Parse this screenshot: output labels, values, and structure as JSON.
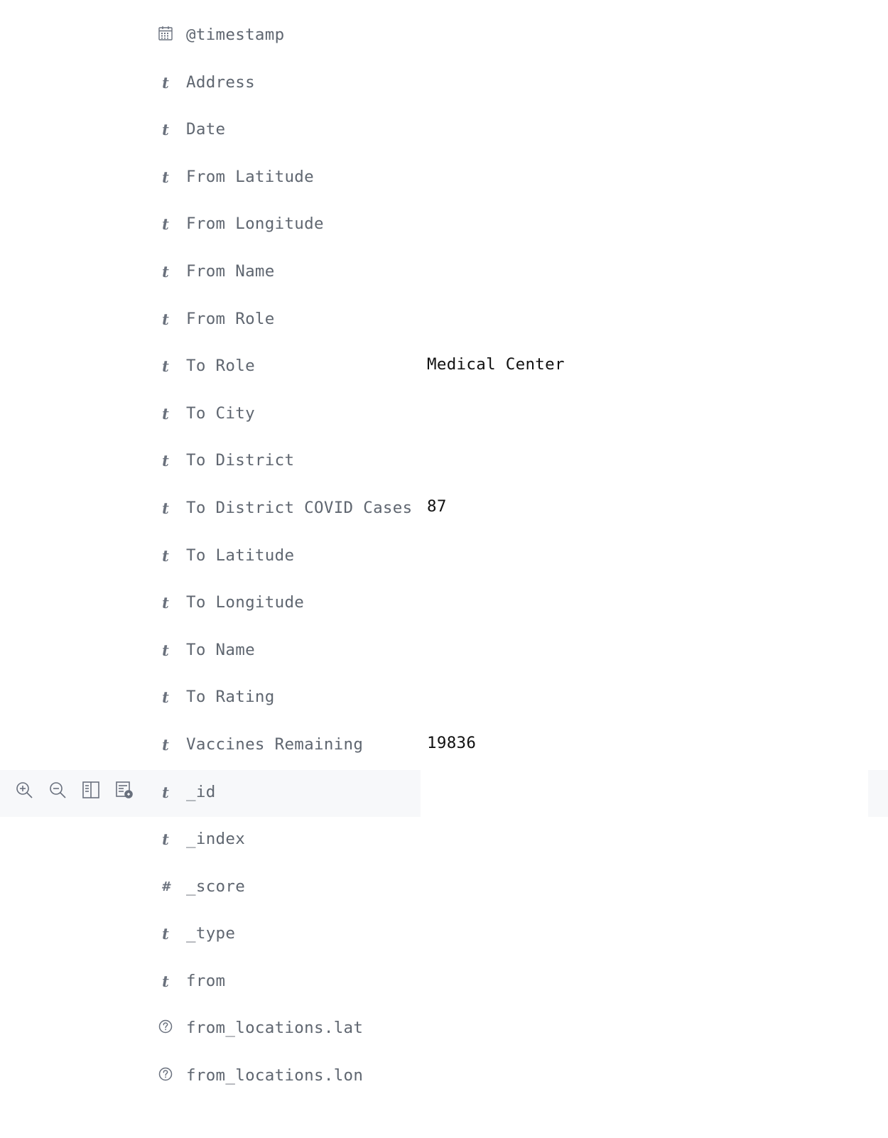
{
  "actions": [
    {
      "icon": "zoom-in-icon",
      "label": "Filter for value"
    },
    {
      "icon": "zoom-out-icon",
      "label": "Filter out value"
    },
    {
      "icon": "toggle-column-icon",
      "label": "Toggle column in table"
    },
    {
      "icon": "filter-exists-icon",
      "label": "Filter for field present"
    }
  ],
  "fields": [
    {
      "type": "date",
      "name": "@timestamp",
      "value": ""
    },
    {
      "type": "string",
      "name": "Address",
      "value": ""
    },
    {
      "type": "string",
      "name": "Date",
      "value": ""
    },
    {
      "type": "string",
      "name": "From Latitude",
      "value": ""
    },
    {
      "type": "string",
      "name": "From Longitude",
      "value": ""
    },
    {
      "type": "string",
      "name": "From Name",
      "value": ""
    },
    {
      "type": "string",
      "name": "From Role",
      "value": ""
    },
    {
      "type": "string",
      "name": "To Role",
      "value": "Medical Center"
    },
    {
      "type": "string",
      "name": "To City",
      "value": ""
    },
    {
      "type": "string",
      "name": "To District",
      "value": ""
    },
    {
      "type": "string",
      "name": "To District COVID Cases",
      "value": "87"
    },
    {
      "type": "string",
      "name": "To Latitude",
      "value": ""
    },
    {
      "type": "string",
      "name": "To Longitude",
      "value": ""
    },
    {
      "type": "string",
      "name": "To Name",
      "value": ""
    },
    {
      "type": "string",
      "name": "To Rating",
      "value": ""
    },
    {
      "type": "string",
      "name": "Vaccines Remaining",
      "value": "19836"
    },
    {
      "type": "string",
      "name": "_id",
      "value": "",
      "hovered": true
    },
    {
      "type": "string",
      "name": "_index",
      "value": ""
    },
    {
      "type": "number",
      "name": "_score",
      "value": ""
    },
    {
      "type": "string",
      "name": "_type",
      "value": ""
    },
    {
      "type": "string",
      "name": "from",
      "value": ""
    },
    {
      "type": "unknown",
      "name": "from_locations.lat",
      "value": ""
    },
    {
      "type": "unknown",
      "name": "from_locations.lon",
      "value": ""
    }
  ],
  "type_glyphs": {
    "string": "t",
    "number": "#"
  },
  "colors": {
    "field_name": "#5f6670",
    "field_value": "#111111",
    "icon": "#69707d",
    "hover_bg": "#f7f8fa"
  }
}
